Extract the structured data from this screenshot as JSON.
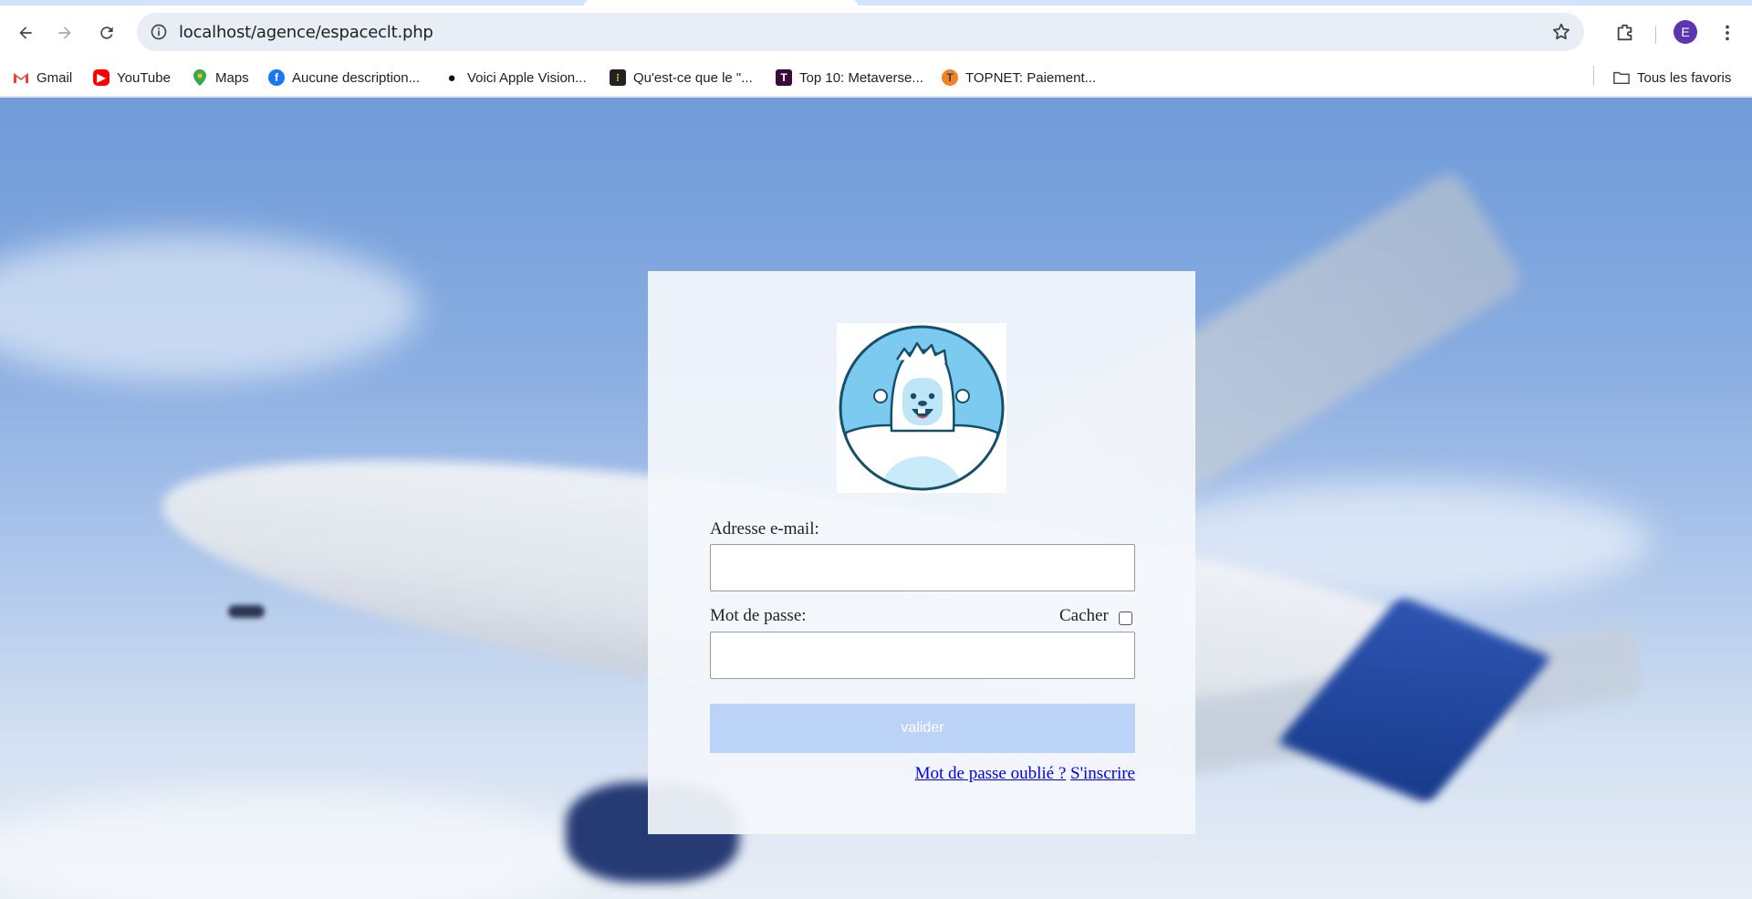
{
  "browser": {
    "url": "localhost/agence/espaceclt.php",
    "profile_initial": "E",
    "bookmarks": [
      {
        "label": "Gmail",
        "icon": "gmail-icon"
      },
      {
        "label": "YouTube",
        "icon": "youtube-icon"
      },
      {
        "label": "Maps",
        "icon": "maps-icon"
      },
      {
        "label": "Aucune description...",
        "icon": "facebook-icon"
      },
      {
        "label": "Voici Apple Vision...",
        "icon": "apple-icon"
      },
      {
        "label": "Qu'est-ce que le \"...",
        "icon": "site-icon"
      },
      {
        "label": "Top 10: Metaverse...",
        "icon": "t-icon"
      },
      {
        "label": "TOPNET: Paiement...",
        "icon": "topnet-icon"
      }
    ],
    "all_bookmarks_label": "Tous les favoris"
  },
  "login": {
    "email_label": "Adresse e-mail:",
    "email_value": "",
    "password_label": "Mot de passe:",
    "hide_label": "Cacher",
    "hide_checked": false,
    "password_value": "",
    "submit_label": "valider",
    "forgot_label": "Mot de passe oublié ?",
    "register_label": "S'inscrire"
  },
  "colors": {
    "submit_bg": "#bcd3f8",
    "link": "#0000ee",
    "profile_bg": "#5e35b1"
  }
}
